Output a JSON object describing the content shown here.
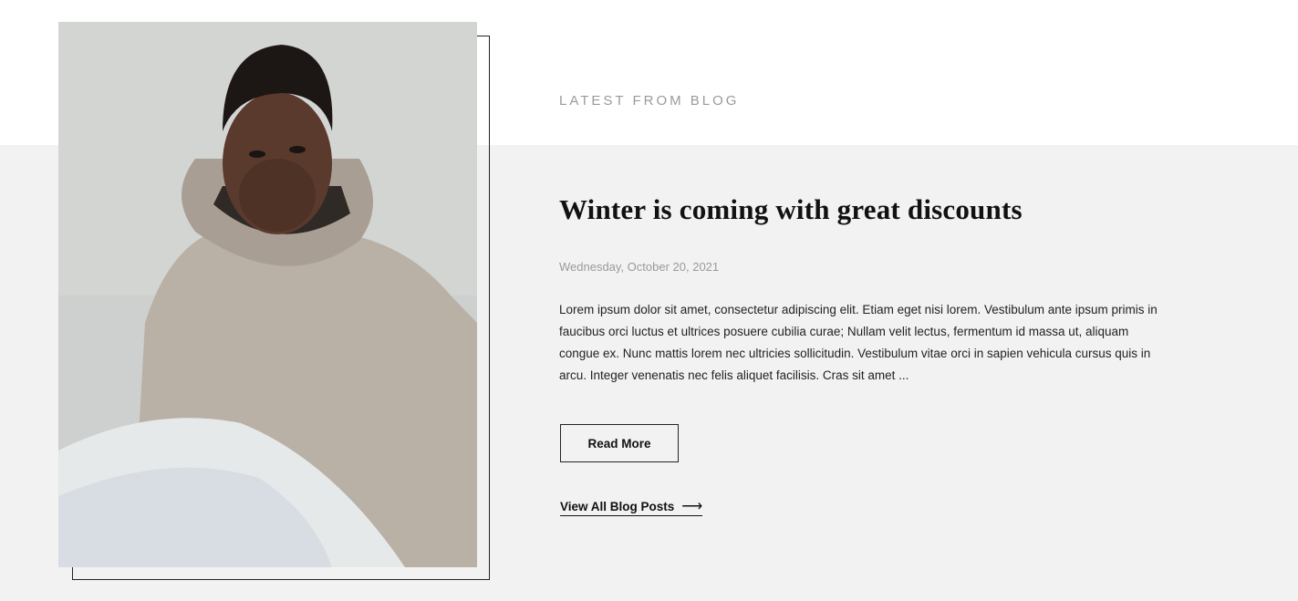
{
  "section": {
    "kicker": "LATEST FROM BLOG"
  },
  "post": {
    "title": "Winter is coming with great discounts",
    "date": "Wednesday, October 20, 2021",
    "excerpt": "Lorem ipsum dolor sit amet, consectetur adipiscing elit. Etiam eget nisi lorem. Vestibulum ante ipsum primis in faucibus orci luctus et ultrices posuere cubilia curae; Nullam velit lectus, fermentum id massa ut, aliquam congue ex. Nunc mattis lorem nec ultricies sollicitudin. Vestibulum vitae orci in sapien vehicula cursus quis in arcu. Integer venenatis nec felis aliquet facilisis. Cras sit amet ...",
    "read_more_label": "Read More",
    "image_icon": "man-in-hoodie-photo"
  },
  "links": {
    "view_all_label": "View All Blog Posts",
    "arrow_icon": "arrow-right-icon"
  },
  "colors": {
    "band_bg": "#f2f2f2",
    "kicker": "#9a9a9a",
    "text": "#111111"
  }
}
